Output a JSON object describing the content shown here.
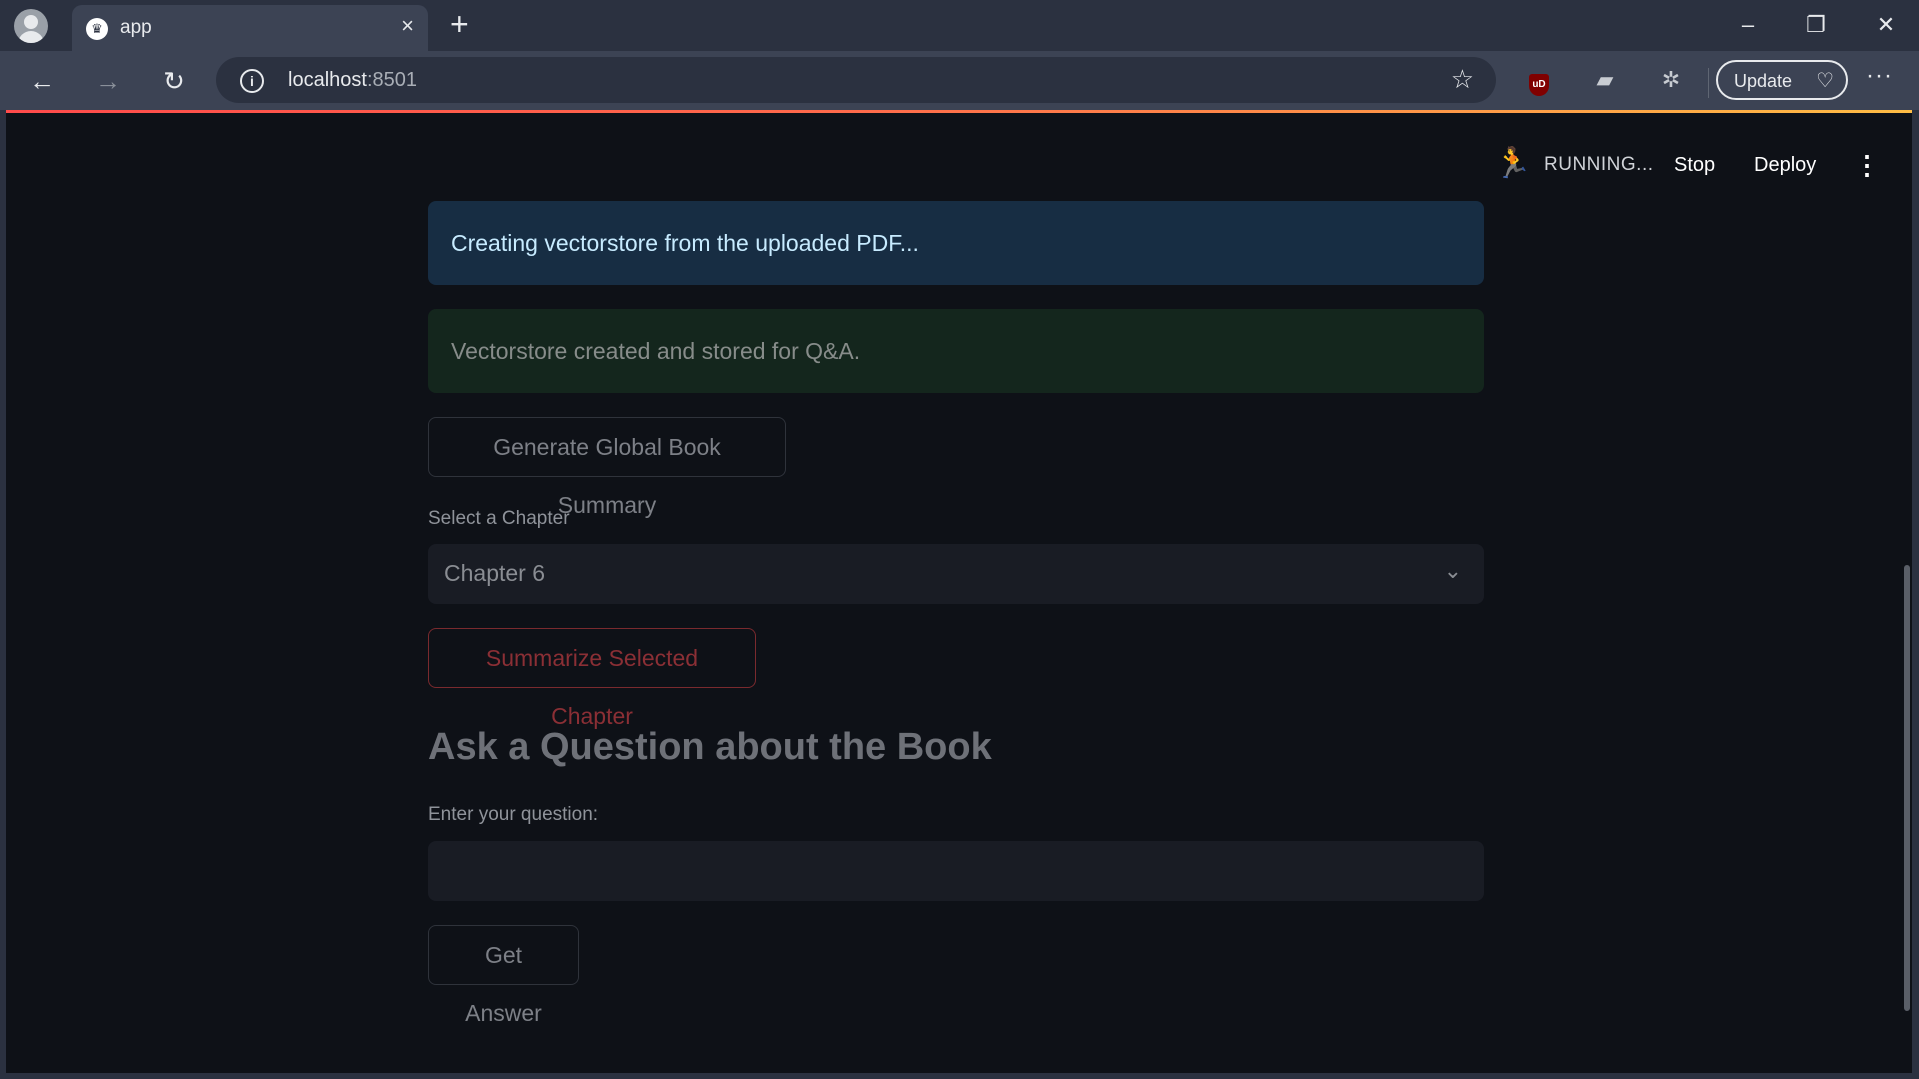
{
  "browser": {
    "tab_title": "app",
    "tab_favicon": "crown-icon",
    "url_host": "localhost",
    "url_port": ":8501",
    "update_label": "Update",
    "icons": {
      "close": "×",
      "new_tab": "+",
      "minimize": "–",
      "restore": "❐",
      "window_close": "✕",
      "back": "←",
      "forward": "→",
      "reload": "↻",
      "info": "i",
      "star": "☆",
      "ublock": "uD",
      "extension_folder": "▰",
      "puzzle": "✲",
      "update_badge": "♡",
      "menu": "···"
    }
  },
  "app_header": {
    "status": "RUNNING...",
    "stop_label": "Stop",
    "deploy_label": "Deploy",
    "running_icon": "🏃",
    "menu_icon": "⋮"
  },
  "main": {
    "info_message": "Creating vectorstore from the uploaded PDF...",
    "success_message": "Vectorstore created and stored for Q&A.",
    "global_summary_button": "Generate Global Book Summary",
    "chapter_select": {
      "label": "Select a Chapter",
      "value": "Chapter 6",
      "chevron": "⌄"
    },
    "summarize_chapter_button": "Summarize Selected Chapter",
    "qa_heading": "Ask a Question about the Book",
    "question_label": "Enter your question:",
    "question_value": "",
    "get_answer_button": "Get Answer"
  },
  "colors": {
    "page_background": "#0e1117",
    "info_background": "#172d43",
    "success_background": "#14261d",
    "accent_red": "#ff4b4b"
  }
}
